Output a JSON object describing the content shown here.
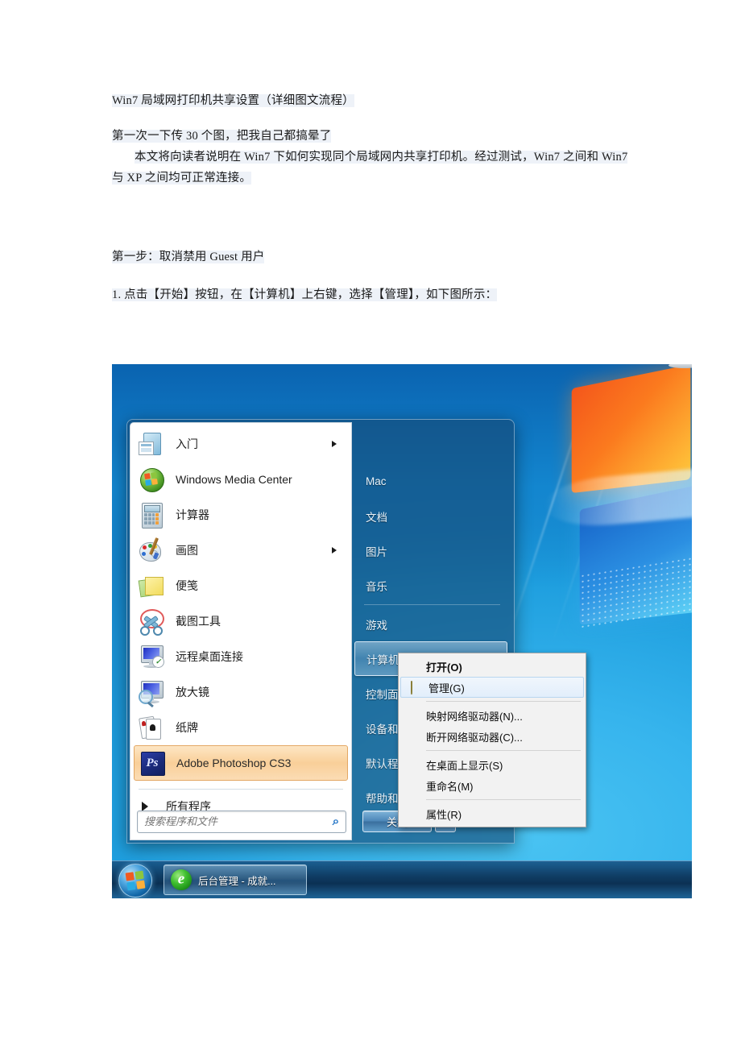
{
  "document": {
    "title": "Win7 局域网打印机共享设置（详细图文流程）",
    "paragraph1": "第一次一下传 30 个图，把我自己都搞晕了",
    "paragraph2": "本文将向读者说明在 Win7 下如何实现同个局域网内共享打印机。经过测试，Win7 之间和 Win7 与 XP 之间均可正常连接。",
    "step_heading": "第一步：取消禁用 Guest 用户",
    "step_item_1": "1. 点击【开始】按钮，在【计算机】上右键，选择【管理】，如下图所示："
  },
  "screenshot": {
    "start_menu": {
      "programs": [
        {
          "label": "入门",
          "icon": "getting-started-icon",
          "has_submenu": true
        },
        {
          "label": "Windows Media Center",
          "icon": "windows-media-center-icon",
          "has_submenu": false
        },
        {
          "label": "计算器",
          "icon": "calculator-icon",
          "has_submenu": false
        },
        {
          "label": "画图",
          "icon": "paint-icon",
          "has_submenu": true
        },
        {
          "label": "便笺",
          "icon": "sticky-notes-icon",
          "has_submenu": false
        },
        {
          "label": "截图工具",
          "icon": "snipping-tool-icon",
          "has_submenu": false
        },
        {
          "label": "远程桌面连接",
          "icon": "remote-desktop-icon",
          "has_submenu": false
        },
        {
          "label": "放大镜",
          "icon": "magnifier-icon",
          "has_submenu": false
        },
        {
          "label": "纸牌",
          "icon": "solitaire-icon",
          "has_submenu": false
        },
        {
          "label": "Adobe Photoshop CS3",
          "icon": "photoshop-icon",
          "has_submenu": false,
          "selected": true
        }
      ],
      "all_programs_label": "所有程序",
      "search_placeholder": "搜索程序和文件",
      "search_value": "",
      "right_items": [
        {
          "label": "Mac",
          "separator_after": false
        },
        {
          "label": "文档",
          "separator_after": false
        },
        {
          "label": "图片",
          "separator_after": false
        },
        {
          "label": "音乐",
          "separator_after": true
        },
        {
          "label": "游戏",
          "separator_after": false
        },
        {
          "label": "计算机",
          "separator_after": false,
          "highlighted": true
        },
        {
          "label": "控制面板",
          "separator_after": false
        },
        {
          "label": "设备和打印机",
          "separator_after": false
        },
        {
          "label": "默认程序",
          "separator_after": false
        },
        {
          "label": "帮助和支持",
          "separator_after": false
        }
      ],
      "shutdown_label": "关机",
      "shutdown_arrow": "▶"
    },
    "context_menu": {
      "items": [
        {
          "label": "打开(O)",
          "bold": true,
          "icon": null,
          "highlighted": false,
          "separator_after": false
        },
        {
          "label": "管理(G)",
          "bold": false,
          "icon": "shield-icon",
          "highlighted": true,
          "separator_after": true
        },
        {
          "label": "映射网络驱动器(N)...",
          "bold": false,
          "icon": null,
          "highlighted": false,
          "separator_after": false
        },
        {
          "label": "断开网络驱动器(C)...",
          "bold": false,
          "icon": null,
          "highlighted": false,
          "separator_after": true
        },
        {
          "label": "在桌面上显示(S)",
          "bold": false,
          "icon": null,
          "highlighted": false,
          "separator_after": false
        },
        {
          "label": "重命名(M)",
          "bold": false,
          "icon": null,
          "highlighted": false,
          "separator_after": true
        },
        {
          "label": "属性(R)",
          "bold": false,
          "icon": null,
          "highlighted": false,
          "separator_after": false
        }
      ]
    },
    "taskbar": {
      "start_button": "start-orb-icon",
      "items": [
        {
          "label": "后台管理 - 成就...",
          "icon": "internet-explorer-icon"
        }
      ]
    }
  },
  "colors": {
    "selection_orange": "#f9cf99",
    "wallpaper_blue": "#1e9ede",
    "taskbar_blue": "#0e385e",
    "context_menu_bg": "#f2f2f2",
    "text_dark": "#1a1a1a"
  }
}
